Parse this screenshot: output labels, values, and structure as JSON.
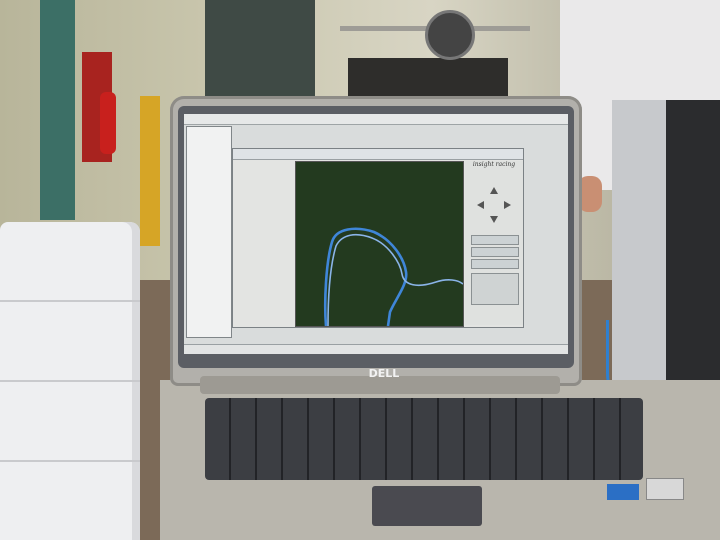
{
  "scene": {
    "laptop_brand": "DELL"
  },
  "app": {
    "brand_logo": "insight racing",
    "track_colors": {
      "background": "#233a1f",
      "path": "#3f86d8"
    }
  },
  "icons": [
    "arrow-up-icon",
    "arrow-down-icon",
    "arrow-left-icon",
    "arrow-right-icon"
  ]
}
